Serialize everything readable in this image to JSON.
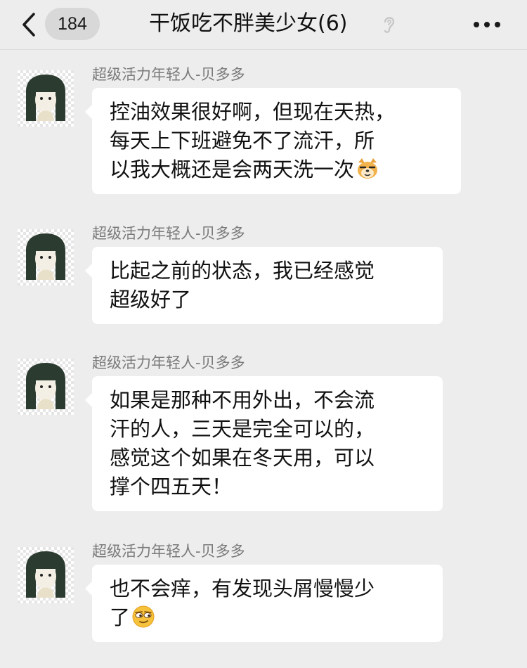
{
  "header": {
    "back_label": "<",
    "unread_count": "184",
    "title": "干饭吃不胖美少女(6)",
    "more_label": "•••"
  },
  "messages": [
    {
      "sender": "超级活力年轻人-贝多多",
      "lines": [
        "控油效果很好啊，但现在天热，",
        "每天上下班避免不了流汗，所",
        "以我大概还是会两天洗一次"
      ],
      "trailing_emoji": "doge-emoji"
    },
    {
      "sender": "超级活力年轻人-贝多多",
      "lines": [
        "比起之前的状态，我已经感觉",
        "超级好了"
      ]
    },
    {
      "sender": "超级活力年轻人-贝多多",
      "lines": [
        "如果是那种不用外出，不会流",
        "汗的人，三天是完全可以的，",
        "感觉这个如果在冬天用，可以",
        "撑个四五天！"
      ]
    },
    {
      "sender": "超级活力年轻人-贝多多",
      "lines": [
        "也不会痒，有发现头屑慢慢少",
        "了"
      ],
      "trailing_emoji": "smug-face-emoji"
    }
  ],
  "colors": {
    "background": "#ededed",
    "bubble": "#ffffff",
    "sender_name": "#7a7a7a",
    "text": "#111111",
    "emoji_yellow": "#f7c23b"
  }
}
